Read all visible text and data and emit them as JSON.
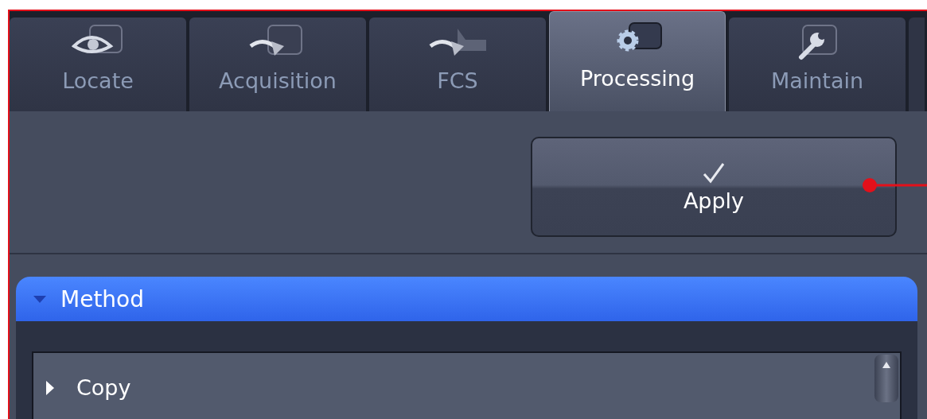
{
  "tabs": [
    {
      "label": "Locate",
      "selected": false
    },
    {
      "label": "Acquisition",
      "selected": false
    },
    {
      "label": "FCS",
      "selected": false
    },
    {
      "label": "Processing",
      "selected": true
    },
    {
      "label": "Maintain",
      "selected": false
    }
  ],
  "apply_button": {
    "label": "Apply"
  },
  "method_panel": {
    "title": "Method",
    "expanded": true,
    "items": [
      {
        "label": "Copy",
        "expanded": false
      }
    ]
  }
}
